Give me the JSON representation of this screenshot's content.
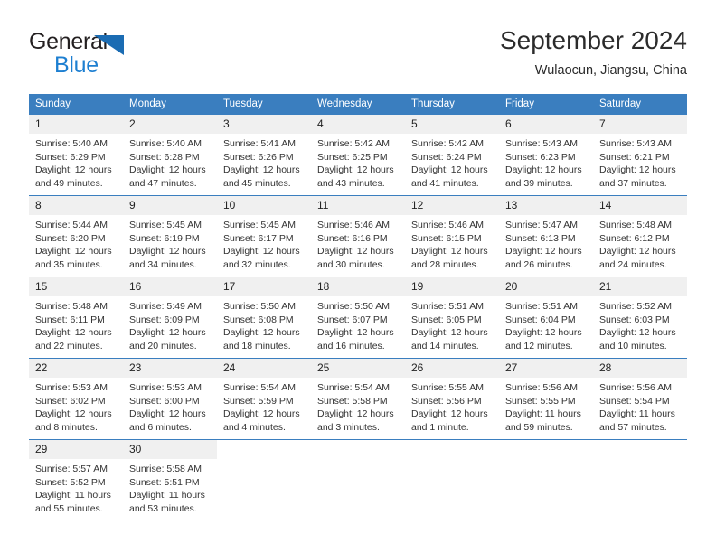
{
  "brand": {
    "name_part1": "General",
    "name_part2": "Blue",
    "triangle_color": "#1b6cb3",
    "blue_color": "#1d7fd1"
  },
  "header": {
    "title": "September 2024",
    "subtitle": "Wulaocun, Jiangsu, China"
  },
  "theme": {
    "header_blue": "#3a7ebf",
    "daynum_bg": "#f0f0f0",
    "text": "#333333"
  },
  "calendar": {
    "weekday_headers": [
      "Sunday",
      "Monday",
      "Tuesday",
      "Wednesday",
      "Thursday",
      "Friday",
      "Saturday"
    ],
    "weeks": [
      [
        {
          "day": "1",
          "sunrise": "Sunrise: 5:40 AM",
          "sunset": "Sunset: 6:29 PM",
          "daylight1": "Daylight: 12 hours",
          "daylight2": "and 49 minutes."
        },
        {
          "day": "2",
          "sunrise": "Sunrise: 5:40 AM",
          "sunset": "Sunset: 6:28 PM",
          "daylight1": "Daylight: 12 hours",
          "daylight2": "and 47 minutes."
        },
        {
          "day": "3",
          "sunrise": "Sunrise: 5:41 AM",
          "sunset": "Sunset: 6:26 PM",
          "daylight1": "Daylight: 12 hours",
          "daylight2": "and 45 minutes."
        },
        {
          "day": "4",
          "sunrise": "Sunrise: 5:42 AM",
          "sunset": "Sunset: 6:25 PM",
          "daylight1": "Daylight: 12 hours",
          "daylight2": "and 43 minutes."
        },
        {
          "day": "5",
          "sunrise": "Sunrise: 5:42 AM",
          "sunset": "Sunset: 6:24 PM",
          "daylight1": "Daylight: 12 hours",
          "daylight2": "and 41 minutes."
        },
        {
          "day": "6",
          "sunrise": "Sunrise: 5:43 AM",
          "sunset": "Sunset: 6:23 PM",
          "daylight1": "Daylight: 12 hours",
          "daylight2": "and 39 minutes."
        },
        {
          "day": "7",
          "sunrise": "Sunrise: 5:43 AM",
          "sunset": "Sunset: 6:21 PM",
          "daylight1": "Daylight: 12 hours",
          "daylight2": "and 37 minutes."
        }
      ],
      [
        {
          "day": "8",
          "sunrise": "Sunrise: 5:44 AM",
          "sunset": "Sunset: 6:20 PM",
          "daylight1": "Daylight: 12 hours",
          "daylight2": "and 35 minutes."
        },
        {
          "day": "9",
          "sunrise": "Sunrise: 5:45 AM",
          "sunset": "Sunset: 6:19 PM",
          "daylight1": "Daylight: 12 hours",
          "daylight2": "and 34 minutes."
        },
        {
          "day": "10",
          "sunrise": "Sunrise: 5:45 AM",
          "sunset": "Sunset: 6:17 PM",
          "daylight1": "Daylight: 12 hours",
          "daylight2": "and 32 minutes."
        },
        {
          "day": "11",
          "sunrise": "Sunrise: 5:46 AM",
          "sunset": "Sunset: 6:16 PM",
          "daylight1": "Daylight: 12 hours",
          "daylight2": "and 30 minutes."
        },
        {
          "day": "12",
          "sunrise": "Sunrise: 5:46 AM",
          "sunset": "Sunset: 6:15 PM",
          "daylight1": "Daylight: 12 hours",
          "daylight2": "and 28 minutes."
        },
        {
          "day": "13",
          "sunrise": "Sunrise: 5:47 AM",
          "sunset": "Sunset: 6:13 PM",
          "daylight1": "Daylight: 12 hours",
          "daylight2": "and 26 minutes."
        },
        {
          "day": "14",
          "sunrise": "Sunrise: 5:48 AM",
          "sunset": "Sunset: 6:12 PM",
          "daylight1": "Daylight: 12 hours",
          "daylight2": "and 24 minutes."
        }
      ],
      [
        {
          "day": "15",
          "sunrise": "Sunrise: 5:48 AM",
          "sunset": "Sunset: 6:11 PM",
          "daylight1": "Daylight: 12 hours",
          "daylight2": "and 22 minutes."
        },
        {
          "day": "16",
          "sunrise": "Sunrise: 5:49 AM",
          "sunset": "Sunset: 6:09 PM",
          "daylight1": "Daylight: 12 hours",
          "daylight2": "and 20 minutes."
        },
        {
          "day": "17",
          "sunrise": "Sunrise: 5:50 AM",
          "sunset": "Sunset: 6:08 PM",
          "daylight1": "Daylight: 12 hours",
          "daylight2": "and 18 minutes."
        },
        {
          "day": "18",
          "sunrise": "Sunrise: 5:50 AM",
          "sunset": "Sunset: 6:07 PM",
          "daylight1": "Daylight: 12 hours",
          "daylight2": "and 16 minutes."
        },
        {
          "day": "19",
          "sunrise": "Sunrise: 5:51 AM",
          "sunset": "Sunset: 6:05 PM",
          "daylight1": "Daylight: 12 hours",
          "daylight2": "and 14 minutes."
        },
        {
          "day": "20",
          "sunrise": "Sunrise: 5:51 AM",
          "sunset": "Sunset: 6:04 PM",
          "daylight1": "Daylight: 12 hours",
          "daylight2": "and 12 minutes."
        },
        {
          "day": "21",
          "sunrise": "Sunrise: 5:52 AM",
          "sunset": "Sunset: 6:03 PM",
          "daylight1": "Daylight: 12 hours",
          "daylight2": "and 10 minutes."
        }
      ],
      [
        {
          "day": "22",
          "sunrise": "Sunrise: 5:53 AM",
          "sunset": "Sunset: 6:02 PM",
          "daylight1": "Daylight: 12 hours",
          "daylight2": "and 8 minutes."
        },
        {
          "day": "23",
          "sunrise": "Sunrise: 5:53 AM",
          "sunset": "Sunset: 6:00 PM",
          "daylight1": "Daylight: 12 hours",
          "daylight2": "and 6 minutes."
        },
        {
          "day": "24",
          "sunrise": "Sunrise: 5:54 AM",
          "sunset": "Sunset: 5:59 PM",
          "daylight1": "Daylight: 12 hours",
          "daylight2": "and 4 minutes."
        },
        {
          "day": "25",
          "sunrise": "Sunrise: 5:54 AM",
          "sunset": "Sunset: 5:58 PM",
          "daylight1": "Daylight: 12 hours",
          "daylight2": "and 3 minutes."
        },
        {
          "day": "26",
          "sunrise": "Sunrise: 5:55 AM",
          "sunset": "Sunset: 5:56 PM",
          "daylight1": "Daylight: 12 hours",
          "daylight2": "and 1 minute."
        },
        {
          "day": "27",
          "sunrise": "Sunrise: 5:56 AM",
          "sunset": "Sunset: 5:55 PM",
          "daylight1": "Daylight: 11 hours",
          "daylight2": "and 59 minutes."
        },
        {
          "day": "28",
          "sunrise": "Sunrise: 5:56 AM",
          "sunset": "Sunset: 5:54 PM",
          "daylight1": "Daylight: 11 hours",
          "daylight2": "and 57 minutes."
        }
      ],
      [
        {
          "day": "29",
          "sunrise": "Sunrise: 5:57 AM",
          "sunset": "Sunset: 5:52 PM",
          "daylight1": "Daylight: 11 hours",
          "daylight2": "and 55 minutes."
        },
        {
          "day": "30",
          "sunrise": "Sunrise: 5:58 AM",
          "sunset": "Sunset: 5:51 PM",
          "daylight1": "Daylight: 11 hours",
          "daylight2": "and 53 minutes."
        },
        {
          "day": "",
          "sunrise": "",
          "sunset": "",
          "daylight1": "",
          "daylight2": ""
        },
        {
          "day": "",
          "sunrise": "",
          "sunset": "",
          "daylight1": "",
          "daylight2": ""
        },
        {
          "day": "",
          "sunrise": "",
          "sunset": "",
          "daylight1": "",
          "daylight2": ""
        },
        {
          "day": "",
          "sunrise": "",
          "sunset": "",
          "daylight1": "",
          "daylight2": ""
        },
        {
          "day": "",
          "sunrise": "",
          "sunset": "",
          "daylight1": "",
          "daylight2": ""
        }
      ]
    ]
  }
}
